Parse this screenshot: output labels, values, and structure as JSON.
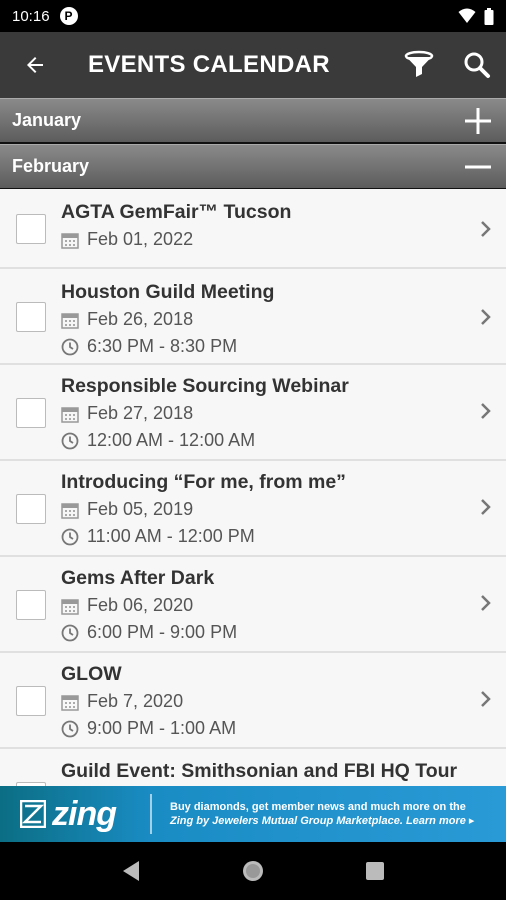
{
  "status": {
    "time": "10:16",
    "p_label": "P"
  },
  "appbar": {
    "title": "EVENTS CALENDAR"
  },
  "months": [
    {
      "label": "January",
      "expanded": false
    },
    {
      "label": "February",
      "expanded": true
    }
  ],
  "events": [
    {
      "name": "AGTA GemFair™ Tucson",
      "date": "Feb 01, 2022",
      "time": ""
    },
    {
      "name": "Houston Guild Meeting",
      "date": "Feb 26, 2018",
      "time": "6:30 PM - 8:30 PM"
    },
    {
      "name": "Responsible Sourcing Webinar",
      "date": "Feb 27, 2018",
      "time": "12:00 AM - 12:00 AM"
    },
    {
      "name": "Introducing “For me, from me”",
      "date": "Feb 05, 2019",
      "time": "11:00 AM - 12:00 PM"
    },
    {
      "name": "Gems After Dark",
      "date": "Feb 06, 2020",
      "time": "6:00 PM - 9:00 PM"
    },
    {
      "name": "GLOW",
      "date": "Feb 7, 2020",
      "time": "9:00 PM - 1:00 AM"
    },
    {
      "name": "Guild Event: Smithsonian and FBI HQ Tour",
      "date": "",
      "time": ""
    }
  ],
  "ad": {
    "brand": "zing",
    "line1": "Buy diamonds, get member news and much more on the",
    "line2": "Zing by Jewelers Mutual Group Marketplace. Learn more ▸"
  },
  "colors": {
    "appbar": "#3a3a3a",
    "ad": "#1a8cc4"
  }
}
